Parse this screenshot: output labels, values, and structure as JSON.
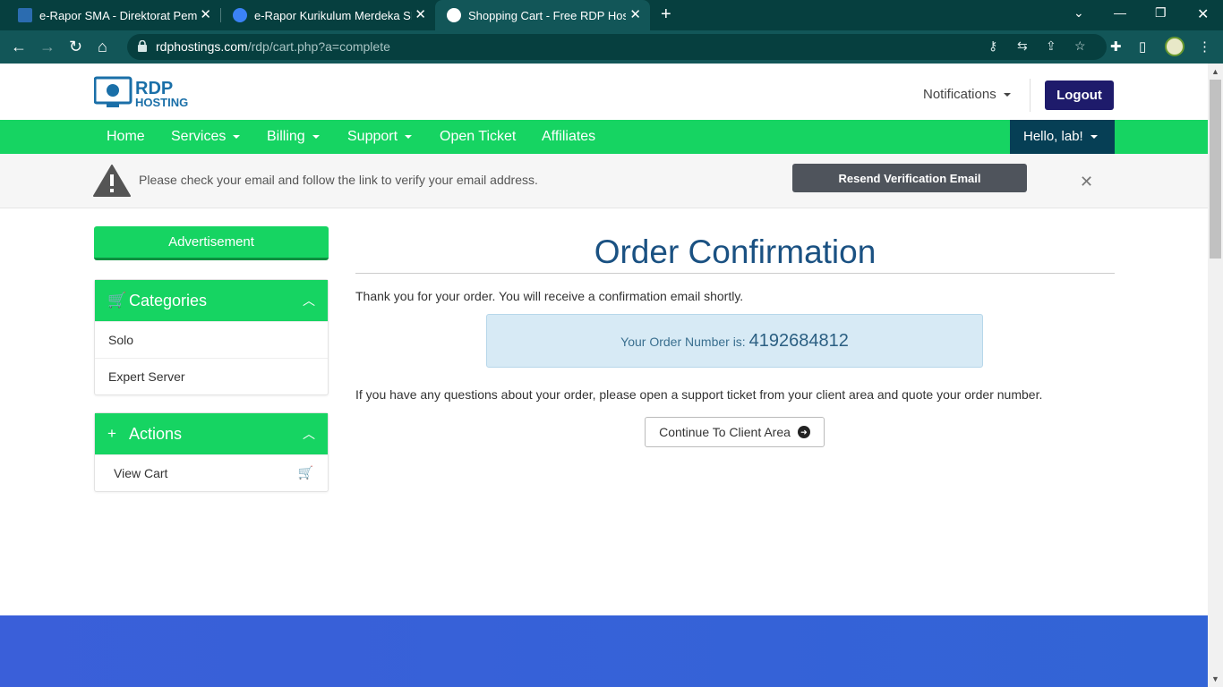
{
  "browser": {
    "tabs": [
      {
        "title": "e-Rapor SMA - Direktorat Pembin",
        "active": false
      },
      {
        "title": "e-Rapor Kurikulum Merdeka SMA",
        "active": false
      },
      {
        "title": "Shopping Cart - Free RDP Hostin",
        "active": true
      }
    ],
    "url_host": "rdphostings.com",
    "url_path": "/rdp/cart.php?a=complete"
  },
  "header": {
    "logo_text_top": "RDP",
    "logo_text_bottom": "HOSTING",
    "notifications_label": "Notifications",
    "logout_label": "Logout"
  },
  "nav": {
    "items": [
      "Home",
      "Services",
      "Billing",
      "Support",
      "Open Ticket",
      "Affiliates"
    ],
    "user_label": "Hello, lab!"
  },
  "verify_bar": {
    "message": "Please check your email and follow the link to verify your email address.",
    "resend_label": "Resend Verification Email"
  },
  "sidebar": {
    "advertisement_label": "Advertisement",
    "categories_title": "Categories",
    "categories": [
      "Solo",
      "Expert Server"
    ],
    "actions_title": "Actions",
    "actions": [
      "View Cart"
    ]
  },
  "main": {
    "title": "Order Confirmation",
    "thanks_text": "Thank you for your order. You will receive a confirmation email shortly.",
    "order_label": "Your Order Number is:",
    "order_number": "4192684812",
    "questions_text": "If you have any questions about your order, please open a support ticket from your client area and quote your order number.",
    "continue_label": "Continue To Client Area"
  },
  "colors": {
    "accent_green": "#16d462",
    "navy": "#1e1b6b",
    "title_blue": "#1a5182",
    "footer_blue": "#3a5fd9"
  }
}
